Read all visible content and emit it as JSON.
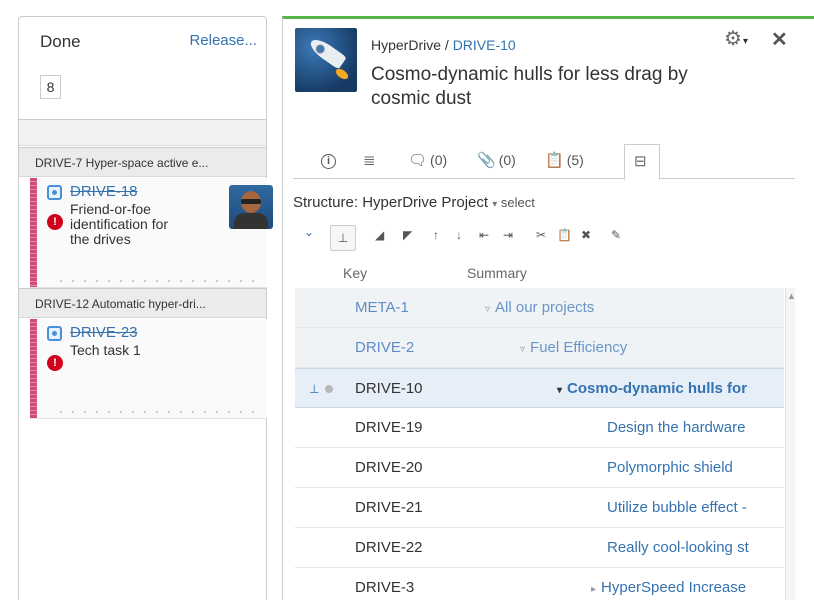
{
  "board": {
    "column": {
      "title": "Done",
      "release_label": "Release...",
      "count": "8"
    },
    "swimlanes": [
      {
        "label": "DRIVE-7  Hyper-space active e...",
        "card": {
          "key": "DRIVE-18",
          "summary_lines": [
            "Friend-or-foe",
            "identification for",
            "the drives"
          ],
          "priority_icon": "priority-blocker-icon"
        }
      },
      {
        "label": "DRIVE-12  Automatic hyper-dri...",
        "card": {
          "key": "DRIVE-23",
          "summary_lines": [
            "Tech task 1"
          ],
          "priority_icon": "priority-blocker-icon"
        }
      }
    ]
  },
  "detail": {
    "project": "HyperDrive",
    "separator": "/",
    "key": "DRIVE-10",
    "title": "Cosmo-dynamic hulls for less drag by cosmic dust",
    "tabs": [
      {
        "id": "info",
        "label": "",
        "icon": "info-icon"
      },
      {
        "id": "description",
        "label": "",
        "icon": "lines-icon"
      },
      {
        "id": "comments",
        "label": "(0)",
        "icon": "comment-icon"
      },
      {
        "id": "attachments",
        "label": "(0)",
        "icon": "paperclip-icon"
      },
      {
        "id": "subtasks",
        "label": "(5)",
        "icon": "clipboard-icon"
      },
      {
        "id": "structure",
        "label": "",
        "icon": "structure-icon",
        "active": true
      }
    ],
    "structure": {
      "prefix": "Structure: HyperDrive Project",
      "select_label": "select"
    },
    "grid": {
      "columns": [
        "Key",
        "Summary"
      ],
      "rows": [
        {
          "key": "META-1",
          "summary": "All our projects",
          "depth": 0,
          "expander": "▿",
          "style": "grey"
        },
        {
          "key": "DRIVE-2",
          "summary": "Fuel Efficiency",
          "depth": 1,
          "expander": "▿",
          "style": "grey"
        },
        {
          "key": "DRIVE-10",
          "summary": "Cosmo-dynamic hulls for",
          "depth": 2,
          "expander": "▾",
          "style": "selected"
        },
        {
          "key": "DRIVE-19",
          "summary": "Design the hardware",
          "depth": 3,
          "expander": "",
          "style": "normal"
        },
        {
          "key": "DRIVE-20",
          "summary": "Polymorphic shield",
          "depth": 3,
          "expander": "",
          "style": "normal"
        },
        {
          "key": "DRIVE-21",
          "summary": "Utilize bubble effect -",
          "depth": 3,
          "expander": "",
          "style": "normal"
        },
        {
          "key": "DRIVE-22",
          "summary": "Really cool-looking st",
          "depth": 3,
          "expander": "",
          "style": "normal"
        },
        {
          "key": "DRIVE-3",
          "summary": "HyperSpeed Increase",
          "depth": 2,
          "expander": "▸",
          "style": "normal"
        }
      ]
    }
  },
  "colors": {
    "accent_green": "#59b44b",
    "link_blue": "#3572b0",
    "priority_red": "#d0021b",
    "epic_stripe": "#d04a7c"
  }
}
